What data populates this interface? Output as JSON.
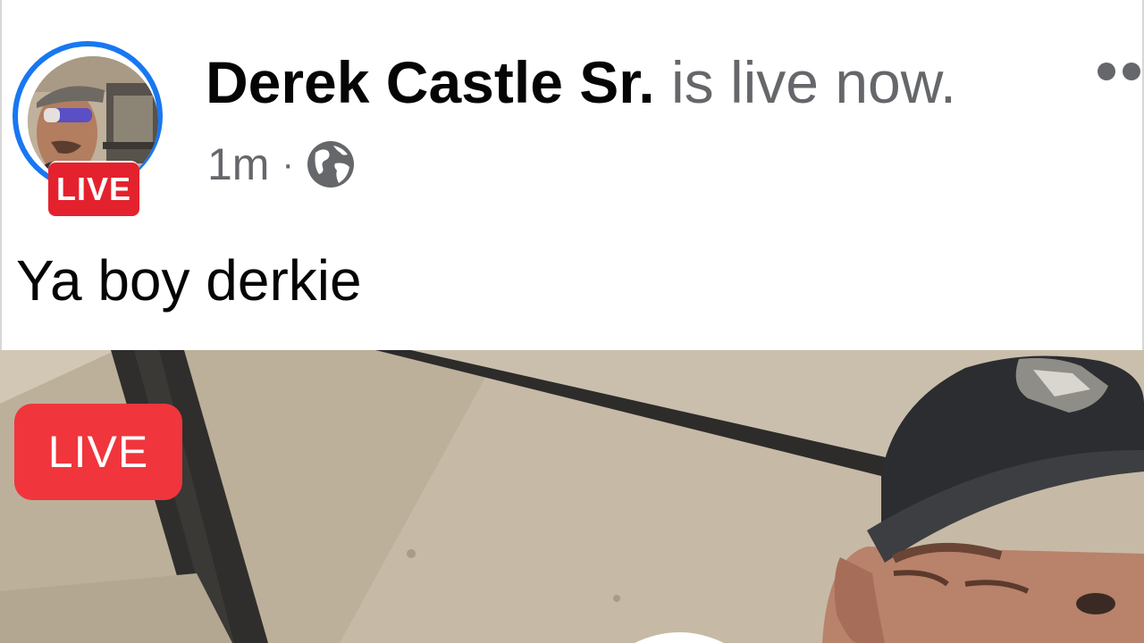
{
  "post": {
    "author_name": "Derek Castle Sr.",
    "status_text": "is live now.",
    "timestamp": "1m",
    "separator": "·",
    "audience_icon": "globe-icon",
    "caption": "Ya boy derkie",
    "avatar_badge": "LIVE",
    "menu_icon": "more-options-icon"
  },
  "video": {
    "live_badge": "LIVE"
  },
  "colors": {
    "live_red": "#e4222e",
    "ring_blue": "#1877f2",
    "secondary_text": "#65676b"
  }
}
